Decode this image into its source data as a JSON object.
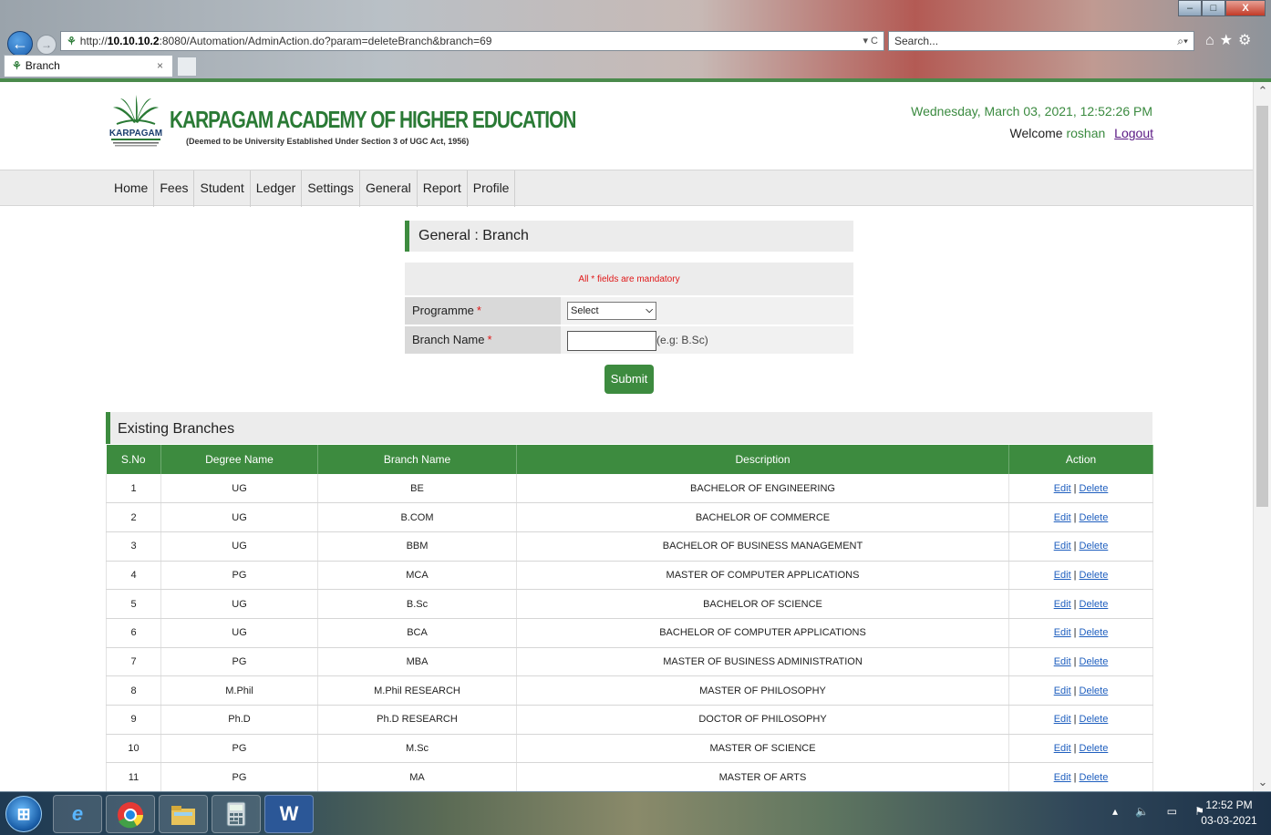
{
  "browser": {
    "url_prefix": "http://",
    "url_host": "10.10.10.2",
    "url_rest": ":8080/Automation/AdminAction.do?param=deleteBranch&branch=69",
    "url_actions": "▾ C",
    "search_placeholder": "Search...",
    "tab_title": "Branch",
    "tab_close": "×",
    "window_min": "‒",
    "window_max": "□",
    "window_close": "X",
    "toolbar_icons": "⌂★⚙",
    "back": "←",
    "forward": "→",
    "search_icon": "⌕▾"
  },
  "header": {
    "institution_name": "KARPAGAM ACADEMY OF HIGHER EDUCATION",
    "institution_subtitle": "(Deemed to be University Established Under Section 3 of UGC Act, 1956)",
    "logo_text": "KARPAGAM",
    "date_time": "Wednesday, March 03, 2021, 12:52:26 PM",
    "welcome_label": "Welcome",
    "username": "roshan",
    "logout": "Logout"
  },
  "menu": [
    "Home",
    "Fees",
    "Student",
    "Ledger",
    "Settings",
    "General",
    "Report",
    "Profile"
  ],
  "form": {
    "title": "General : Branch",
    "mandatory_note": "All * fields are mandatory",
    "programme_label": "Programme",
    "programme_value": "Select",
    "branch_label": "Branch Name",
    "required_mark": "*",
    "branch_hint": "(e.g: B.Sc)",
    "submit_label": "Submit"
  },
  "branches": {
    "title": "Existing Branches",
    "headers": [
      "S.No",
      "Degree Name",
      "Branch Name",
      "Description",
      "Action"
    ],
    "edit_label": "Edit",
    "delete_label": "Delete",
    "rows": [
      {
        "sno": "1",
        "degree": "UG",
        "branch": "BE",
        "description": "BACHELOR OF ENGINEERING"
      },
      {
        "sno": "2",
        "degree": "UG",
        "branch": "B.COM",
        "description": "BACHELOR OF COMMERCE"
      },
      {
        "sno": "3",
        "degree": "UG",
        "branch": "BBM",
        "description": "BACHELOR OF BUSINESS MANAGEMENT"
      },
      {
        "sno": "4",
        "degree": "PG",
        "branch": "MCA",
        "description": "MASTER OF COMPUTER APPLICATIONS"
      },
      {
        "sno": "5",
        "degree": "UG",
        "branch": "B.Sc",
        "description": "BACHELOR OF SCIENCE"
      },
      {
        "sno": "6",
        "degree": "UG",
        "branch": "BCA",
        "description": "BACHELOR OF COMPUTER APPLICATIONS"
      },
      {
        "sno": "7",
        "degree": "PG",
        "branch": "MBA",
        "description": "MASTER OF BUSINESS ADMINISTRATION"
      },
      {
        "sno": "8",
        "degree": "M.Phil",
        "branch": "M.Phil RESEARCH",
        "description": "MASTER OF PHILOSOPHY"
      },
      {
        "sno": "9",
        "degree": "Ph.D",
        "branch": "Ph.D RESEARCH",
        "description": "DOCTOR OF PHILOSOPHY"
      },
      {
        "sno": "10",
        "degree": "PG",
        "branch": "M.Sc",
        "description": "MASTER OF SCIENCE"
      },
      {
        "sno": "11",
        "degree": "PG",
        "branch": "MA",
        "description": "MASTER OF ARTS"
      }
    ]
  },
  "taskbar": {
    "time": "12:52 PM",
    "date": "03-03-2021",
    "word_label": "W",
    "ie_label": "e"
  },
  "colors": {
    "brand_green": "#3d8b3f",
    "required_red": "#e01818",
    "link_blue": "#1f5fbf",
    "logout_purple": "#5b1a85"
  }
}
